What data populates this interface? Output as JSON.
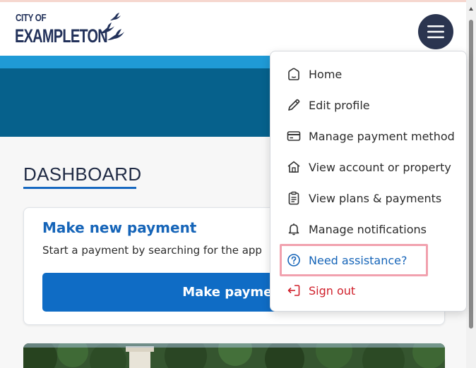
{
  "logo": {
    "line1": "CITY OF",
    "line2": "EXAMPLETON"
  },
  "header": {
    "menu_icon": "hamburger-icon"
  },
  "dashboard": {
    "title": "DASHBOARD",
    "card": {
      "title": "Make new payment",
      "description": "Start a payment by searching for the app",
      "button_label": "Make payment"
    }
  },
  "menu": {
    "items": [
      {
        "label": "Home",
        "icon": "home-icon"
      },
      {
        "label": "Edit profile",
        "icon": "pencil-icon"
      },
      {
        "label": "Manage payment method",
        "icon": "credit-card-icon"
      },
      {
        "label": "View account or property",
        "icon": "house-icon"
      },
      {
        "label": "View plans & payments",
        "icon": "clipboard-icon"
      },
      {
        "label": "Manage notifications",
        "icon": "bell-icon"
      },
      {
        "label": "Need assistance?",
        "icon": "help-circle-icon"
      },
      {
        "label": "Sign out",
        "icon": "sign-out-icon"
      }
    ]
  },
  "colors": {
    "brand_navy": "#2b3550",
    "band_light": "#1f9ad6",
    "band_dark": "#06618c",
    "primary_button": "#0f6cc5",
    "link_blue": "#1564b8",
    "signout_red": "#d0202b",
    "highlight_pink": "#f1a1ae"
  }
}
